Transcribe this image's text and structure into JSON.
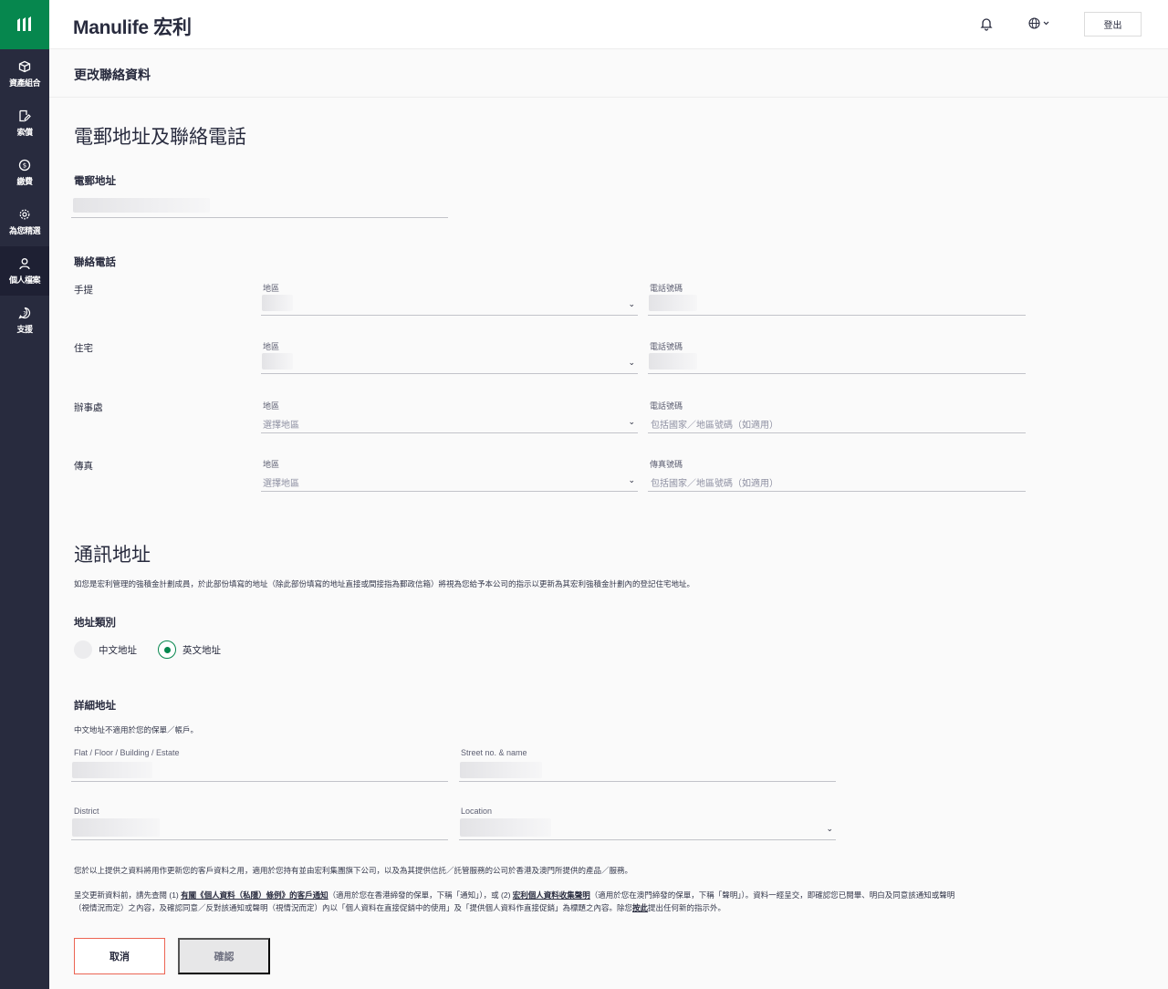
{
  "header": {
    "brand": "Manulife 宏利",
    "logout_label": "登出"
  },
  "sidebar": {
    "items": [
      {
        "label": "資產組合",
        "icon": "box-icon"
      },
      {
        "label": "索償",
        "icon": "edit-doc-icon"
      },
      {
        "label": "繳費",
        "icon": "dollar-icon"
      },
      {
        "label": "為您精選",
        "icon": "gear-icon"
      },
      {
        "label": "個人檔案",
        "icon": "user-icon"
      },
      {
        "label": "支援",
        "icon": "help-icon"
      }
    ]
  },
  "page": {
    "title": "更改聯絡資料"
  },
  "contact": {
    "heading": "電郵地址及聯絡電話",
    "email_label": "電郵地址",
    "phone_heading": "聯絡電話",
    "rows": [
      {
        "label": "手提",
        "region_label": "地區",
        "region_placeholder": "",
        "number_label": "電話號碼",
        "number_placeholder": ""
      },
      {
        "label": "住宅",
        "region_label": "地區",
        "region_placeholder": "",
        "number_label": "電話號碼",
        "number_placeholder": ""
      },
      {
        "label": "辦事處",
        "region_label": "地區",
        "region_placeholder": "選擇地區",
        "number_label": "電話號碼",
        "number_placeholder": "包括國家／地區號碼（如適用）"
      },
      {
        "label": "傳真",
        "region_label": "地區",
        "region_placeholder": "選擇地區",
        "number_label": "傳真號碼",
        "number_placeholder": "包括國家／地區號碼（如適用）"
      }
    ]
  },
  "address": {
    "heading": "通訊地址",
    "description": "如您是宏利管理的強積金計劃成員，於此部份填寫的地址（除此部份填寫的地址直接或間接指為郵政信箱）將視為您給予本公司的指示以更新為其宏利強積金計劃內的登記住宅地址。",
    "type_label": "地址類別",
    "options": [
      {
        "label": "中文地址",
        "selected": false
      },
      {
        "label": "英文地址",
        "selected": true
      }
    ],
    "detail_heading": "詳細地址",
    "detail_note": "中文地址不適用於您的保單／帳戶。",
    "fields": {
      "flat_label": "Flat / Floor / Building / Estate",
      "street_label": "Street no. & name",
      "district_label": "District",
      "location_label": "Location"
    }
  },
  "footer": {
    "note1": "您於以上提供之資料將用作更新您的客戶資料之用，適用於您持有並由宏利集團旗下公司，以及為其提供信託／託管服務的公司於香港及澳門所提供的產品／服務。",
    "note2_a": "呈交更新資料前，請先查閱 (1) ",
    "note2_link1": "有關《個人資料（私隱）條例》的客戶通知",
    "note2_b": "（適用於您在香港締發的保單，下稱「通知」），或 (2) ",
    "note2_link2": "宏利個人資料收集聲明",
    "note2_c": "（適用於您在澳門締發的保單，下稱「聲明」）。資料一經呈交，即確認您已閱畢、明白及同意該通知或聲明（視情況而定）之內容，及確認同意／反對該通知或聲明（視情況而定）內以「個人資料在直接促銷中的使用」及「提供個人資料作直接促銷」為標題之內容。除您",
    "note2_link3": "按此",
    "note2_d": "提出任何新的指示外。",
    "cancel_label": "取消",
    "confirm_label": "確認"
  },
  "colors": {
    "brand_green": "#06874e",
    "sidebar": "#282b3e",
    "cancel_border": "#ec6453"
  }
}
